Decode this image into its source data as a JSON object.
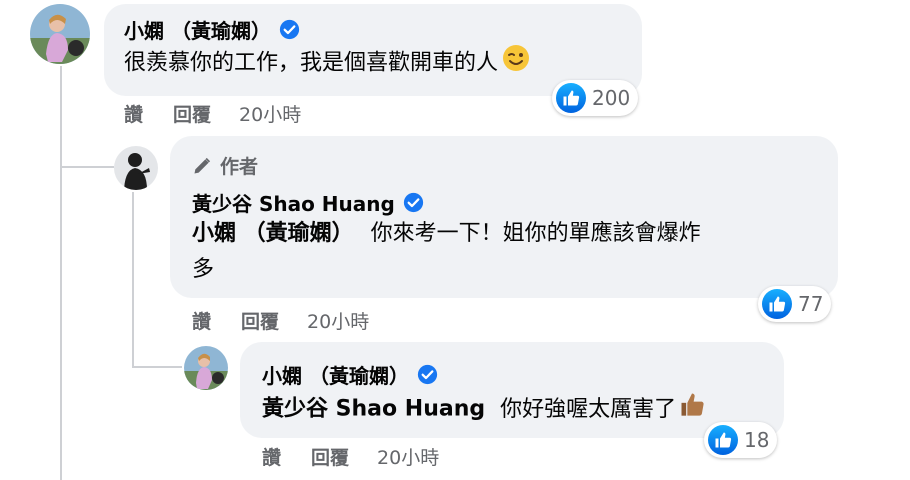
{
  "comments": [
    {
      "author": "小嫻 （黃瑜嫻）",
      "verified": true,
      "text": "很羨慕你的工作，我是個喜歡開車的人",
      "emoji": "wink-emoji",
      "likes": "200",
      "actions": {
        "like": "讚",
        "reply": "回覆",
        "time": "20小時"
      }
    },
    {
      "author_badge": "作者",
      "author": "黃少谷 Shao Huang",
      "verified": true,
      "mention": "小嫻 （黃瑜嫻）",
      "text_line1": "你來考一下！姐你的單應該會爆炸",
      "text_line2": "多",
      "likes": "77",
      "actions": {
        "like": "讚",
        "reply": "回覆",
        "time": "20小時"
      }
    },
    {
      "author": "小嫻 （黃瑜嫻）",
      "verified": true,
      "mention": "黃少谷 Shao Huang",
      "text": "你好強喔太厲害了",
      "emoji": "thumbs-up-emoji",
      "likes": "18",
      "actions": {
        "like": "讚",
        "reply": "回覆",
        "time": "20小時"
      }
    }
  ],
  "colors": {
    "bubble": "#f0f2f5",
    "meta_text": "#65676b",
    "verified": "#1877f2",
    "like_blue": "#1877f2"
  }
}
